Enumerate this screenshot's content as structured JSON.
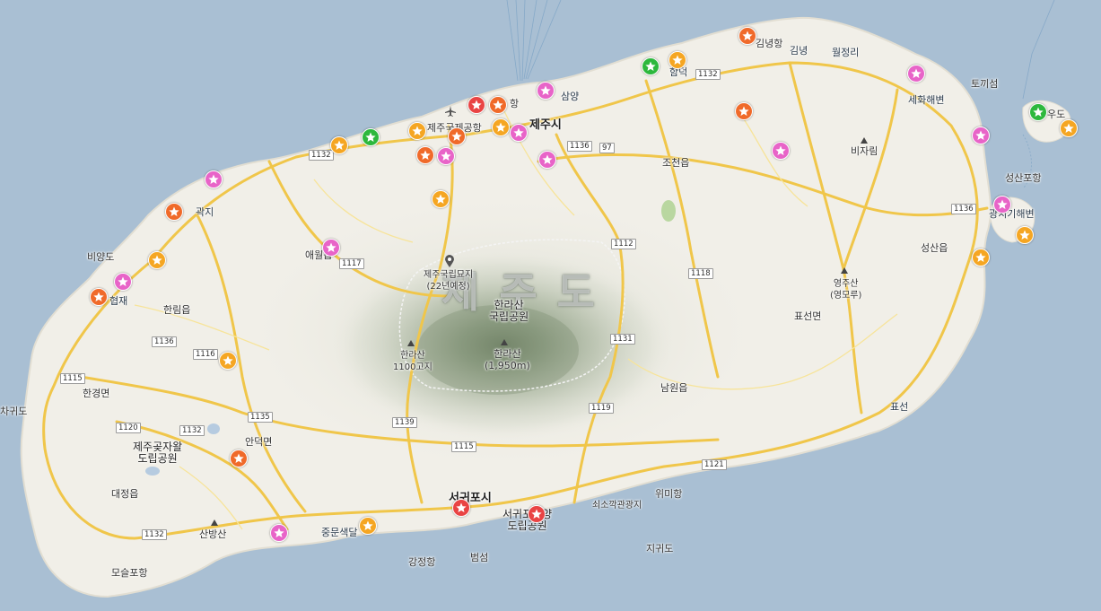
{
  "map": {
    "title": "제주도",
    "labels": {
      "jeju_si": "제주시",
      "seogwipo_si": "서귀포시",
      "jeju_airport": "제주국제공항",
      "hallasan_park": "한라산\n국립공원",
      "hallasan_peak": "한라산\n(1,950m)",
      "hallasan_1100": "한라산\n1100고지",
      "national_cemetery": "제주국립묘지\n(22년예정)",
      "gimnyeong_port": "김녕항",
      "gimnyeong": "김녕",
      "woljeong": "월정리",
      "sehwa_beach": "세화해변",
      "tokkiseom": "토끼섬",
      "udo": "우도",
      "seongsan_port": "성산포항",
      "gwangchigi_beach": "광치기해변",
      "seongsan_eup": "성산읍",
      "yeongjusan": "영주산\n(영모루)",
      "pyoseon_myeon": "표선면",
      "pyoseon": "표선",
      "namwon_eup": "남원읍",
      "wimi_port": "위미항",
      "soesokkak": "쇠소깍관광지",
      "jigwido": "지귀도",
      "seogwipo_marine_park": "서귀포해양\n도립공원",
      "beomseom": "범섬",
      "gangjeong_port": "강정항",
      "jungmun_beach": "중문색달",
      "sanbangsan": "산방산",
      "moseulpo_port": "모슬포항",
      "daejeong_eup": "대정읍",
      "gotjawal_park": "제주곶자왈\n도립공원",
      "andeok_myeon": "안덕면",
      "hangyeong_myeon": "한경면",
      "chagwido": "차귀도",
      "hallim_eup": "한림읍",
      "hyeopjae": "협재",
      "biyangdo": "비양도",
      "gwakji": "곽지",
      "aewol_eup": "애월읍",
      "samyang": "삼양",
      "jocheon_eup": "조천읍",
      "bijarim": "비자림",
      "hamdeok": "함덕",
      "jeju_port": "항"
    },
    "routes": [
      "1132",
      "1136",
      "97",
      "1112",
      "1118",
      "1117",
      "1116",
      "1115",
      "1139",
      "1131",
      "1119",
      "1135",
      "1120",
      "1121",
      "1132",
      "1132",
      "1136",
      "1115",
      "1132"
    ],
    "markers": [
      {
        "name": "hamdeok-marker",
        "color": "#f5a623"
      },
      {
        "name": "gimnyeong-marker",
        "color": "#f06a2a"
      },
      {
        "name": "hamdeok-green-marker",
        "color": "#2db83d"
      },
      {
        "name": "sehwa-marker",
        "color": "#e864c8"
      },
      {
        "name": "udo-green-marker",
        "color": "#2db83d"
      },
      {
        "name": "udo-marker",
        "color": "#f5a623"
      },
      {
        "name": "east-coast-marker",
        "color": "#e864c8"
      },
      {
        "name": "gwangchigi-marker",
        "color": "#e864c8"
      },
      {
        "name": "seongsan-marker",
        "color": "#f5a623"
      },
      {
        "name": "seongsan-south-marker",
        "color": "#f5a623"
      },
      {
        "name": "jocheon-marker",
        "color": "#f06a2a"
      },
      {
        "name": "bijarim-west-marker",
        "color": "#e864c8"
      },
      {
        "name": "samyang-marker",
        "color": "#e864c8"
      },
      {
        "name": "jeju-port-red-marker",
        "color": "#e94444"
      },
      {
        "name": "jeju-port-orange-marker",
        "color": "#f06a2a"
      },
      {
        "name": "jeju-si-marker",
        "color": "#f5a623"
      },
      {
        "name": "jeju-si-pink-marker",
        "color": "#e864c8"
      },
      {
        "name": "jeju-east-pink-marker",
        "color": "#e864c8"
      },
      {
        "name": "airport-yellow-marker",
        "color": "#f5a623"
      },
      {
        "name": "airport-orange-marker",
        "color": "#f06a2a"
      },
      {
        "name": "airport-south-orange-marker",
        "color": "#f06a2a"
      },
      {
        "name": "airport-south-pink-marker",
        "color": "#e864c8"
      },
      {
        "name": "jeju-south-marker",
        "color": "#f5a623"
      },
      {
        "name": "west-green-marker",
        "color": "#2db83d"
      },
      {
        "name": "west-yellow-marker",
        "color": "#f5a623"
      },
      {
        "name": "gwakji-pink-marker",
        "color": "#e864c8"
      },
      {
        "name": "gwakji-marker",
        "color": "#f06a2a"
      },
      {
        "name": "aewol-marker",
        "color": "#e864c8"
      },
      {
        "name": "hallim-yellow-marker",
        "color": "#f5a623"
      },
      {
        "name": "hyeopjae-pink-marker",
        "color": "#e864c8"
      },
      {
        "name": "hyeopjae-marker",
        "color": "#f06a2a"
      },
      {
        "name": "1116-marker",
        "color": "#f5a623"
      },
      {
        "name": "andeok-marker",
        "color": "#f06a2a"
      },
      {
        "name": "sanbang-east-marker",
        "color": "#e864c8"
      },
      {
        "name": "jungmun-marker",
        "color": "#f5a623"
      },
      {
        "name": "seogwipo-marker",
        "color": "#e94444"
      },
      {
        "name": "seogwipo-east-marker",
        "color": "#e94444"
      }
    ],
    "colors": {
      "sea": "#a9bfd3",
      "land": "#f1efe8",
      "road": "#f6cf58",
      "mountain": "#7c8e72"
    }
  }
}
